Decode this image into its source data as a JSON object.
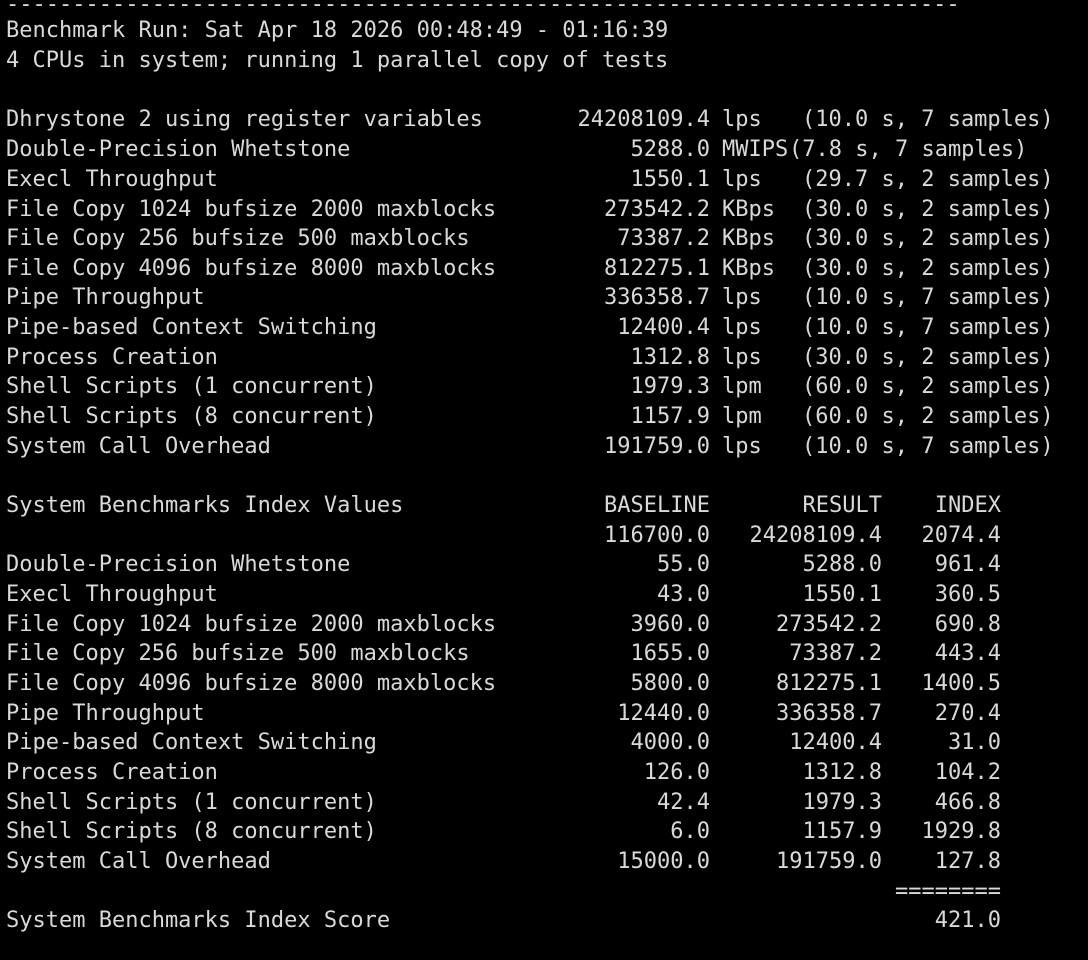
{
  "header": {
    "rule": "--------------------------------------------------------------------------",
    "run_line": "Benchmark Run: Sat Apr 18 2026 00:48:49 - 01:16:39",
    "cpu_line": "4 CPUs in system; running 1 parallel copy of tests"
  },
  "results": [
    {
      "name": "Dhrystone 2 using register variables",
      "value": "24208109.4",
      "unit": "lps",
      "detail": "(10.0 s, 7 samples)"
    },
    {
      "name": "Double-Precision Whetstone",
      "value": "5288.0",
      "unit": "MWIPS",
      "detail": "(7.8 s, 7 samples)"
    },
    {
      "name": "Execl Throughput",
      "value": "1550.1",
      "unit": "lps",
      "detail": "(29.7 s, 2 samples)"
    },
    {
      "name": "File Copy 1024 bufsize 2000 maxblocks",
      "value": "273542.2",
      "unit": "KBps",
      "detail": "(30.0 s, 2 samples)"
    },
    {
      "name": "File Copy 256 bufsize 500 maxblocks",
      "value": "73387.2",
      "unit": "KBps",
      "detail": "(30.0 s, 2 samples)"
    },
    {
      "name": "File Copy 4096 bufsize 8000 maxblocks",
      "value": "812275.1",
      "unit": "KBps",
      "detail": "(30.0 s, 2 samples)"
    },
    {
      "name": "Pipe Throughput",
      "value": "336358.7",
      "unit": "lps",
      "detail": "(10.0 s, 7 samples)"
    },
    {
      "name": "Pipe-based Context Switching",
      "value": "12400.4",
      "unit": "lps",
      "detail": "(10.0 s, 7 samples)"
    },
    {
      "name": "Process Creation",
      "value": "1312.8",
      "unit": "lps",
      "detail": "(30.0 s, 2 samples)"
    },
    {
      "name": "Shell Scripts (1 concurrent)",
      "value": "1979.3",
      "unit": "lpm",
      "detail": "(60.0 s, 2 samples)"
    },
    {
      "name": "Shell Scripts (8 concurrent)",
      "value": "1157.9",
      "unit": "lpm",
      "detail": "(60.0 s, 2 samples)"
    },
    {
      "name": "System Call Overhead",
      "value": "191759.0",
      "unit": "lps",
      "detail": "(10.0 s, 7 samples)"
    }
  ],
  "index_table": {
    "title": "System Benchmarks Index Values",
    "col_baseline": "BASELINE",
    "col_result": "RESULT",
    "col_index": "INDEX",
    "rows": [
      {
        "name": "",
        "baseline": "116700.0",
        "result": "24208109.4",
        "index": "2074.4"
      },
      {
        "name": "Double-Precision Whetstone",
        "baseline": "55.0",
        "result": "5288.0",
        "index": "961.4"
      },
      {
        "name": "Execl Throughput",
        "baseline": "43.0",
        "result": "1550.1",
        "index": "360.5"
      },
      {
        "name": "File Copy 1024 bufsize 2000 maxblocks",
        "baseline": "3960.0",
        "result": "273542.2",
        "index": "690.8"
      },
      {
        "name": "File Copy 256 bufsize 500 maxblocks",
        "baseline": "1655.0",
        "result": "73387.2",
        "index": "443.4"
      },
      {
        "name": "File Copy 4096 bufsize 8000 maxblocks",
        "baseline": "5800.0",
        "result": "812275.1",
        "index": "1400.5"
      },
      {
        "name": "Pipe Throughput",
        "baseline": "12440.0",
        "result": "336358.7",
        "index": "270.4"
      },
      {
        "name": "Pipe-based Context Switching",
        "baseline": "4000.0",
        "result": "12400.4",
        "index": "31.0"
      },
      {
        "name": "Process Creation",
        "baseline": "126.0",
        "result": "1312.8",
        "index": "104.2"
      },
      {
        "name": "Shell Scripts (1 concurrent)",
        "baseline": "42.4",
        "result": "1979.3",
        "index": "466.8"
      },
      {
        "name": "Shell Scripts (8 concurrent)",
        "baseline": "6.0",
        "result": "1157.9",
        "index": "1929.8"
      },
      {
        "name": "System Call Overhead",
        "baseline": "15000.0",
        "result": "191759.0",
        "index": "127.8"
      }
    ],
    "separator": "========",
    "score_label": "System Benchmarks Index Score",
    "score_value": "421.0"
  }
}
